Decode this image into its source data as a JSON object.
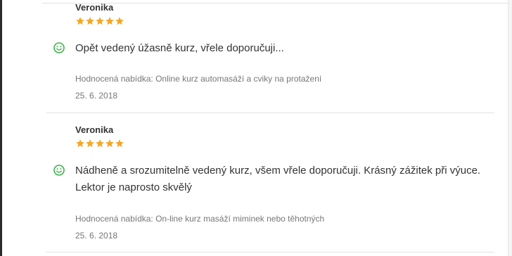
{
  "reviews": [
    {
      "author": "Veronika",
      "rating": 5,
      "star_color": "#f5a623",
      "sentiment_icon": "smile-icon",
      "text": "Opět vedený úžasně kurz, vřele doporučuji...",
      "offer": "Hodnocená nabídka: Online kurz automasáží a cviky na protažení",
      "date": "25. 6. 2018"
    },
    {
      "author": "Veronika",
      "rating": 5,
      "star_color": "#f5a623",
      "sentiment_icon": "smile-icon",
      "text": "Nádheně a srozumitelně vedený kurz, všem vřele doporučuji. Krásný zážitek při výuce. Lektor je naprosto skvělý",
      "offer": "Hodnocená nabídka: On-line kurz masáží miminek nebo těhotných",
      "date": "25. 6. 2018"
    }
  ],
  "colors": {
    "smile": "#3bb34a",
    "star": "#f5a623"
  }
}
